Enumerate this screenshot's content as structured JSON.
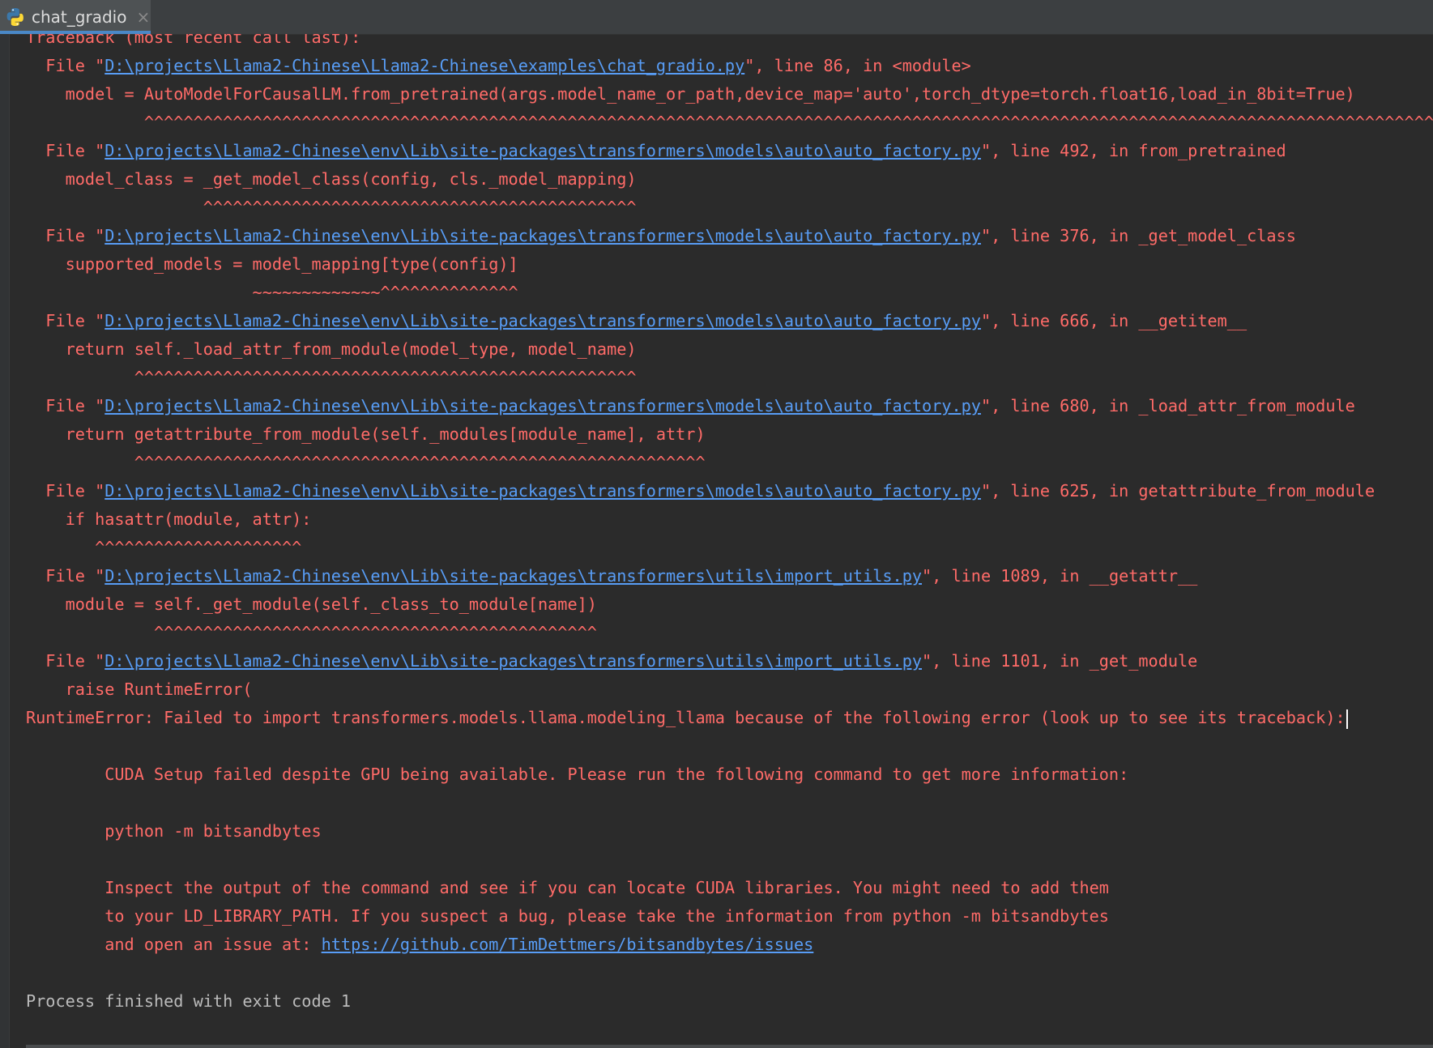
{
  "tab": {
    "title": "chat_gradio",
    "close_glyph": "×",
    "icon": "python-file-icon"
  },
  "console": {
    "partial_header": "Traceback (most recent call last):",
    "frames": [
      {
        "prefix": "  File \"",
        "path": "D:\\projects\\Llama2-Chinese\\Llama2-Chinese\\examples\\chat_gradio.py",
        "suffix": "\", line 86, in <module>",
        "code": "    model = AutoModelForCausalLM.from_pretrained(args.model_name_or_path,device_map='auto',torch_dtype=torch.float16,load_in_8bit=True)",
        "marker": "            ^^^^^^^^^^^^^^^^^^^^^^^^^^^^^^^^^^^^^^^^^^^^^^^^^^^^^^^^^^^^^^^^^^^^^^^^^^^^^^^^^^^^^^^^^^^^^^^^^^^^^^^^^^^^^^^^^^^^^^^^^^^^^^^^^^^^^^^^^^^^"
      },
      {
        "prefix": "  File \"",
        "path": "D:\\projects\\Llama2-Chinese\\env\\Lib\\site-packages\\transformers\\models\\auto\\auto_factory.py",
        "suffix": "\", line 492, in from_pretrained",
        "code": "    model_class = _get_model_class(config, cls._model_mapping)",
        "marker": "                  ^^^^^^^^^^^^^^^^^^^^^^^^^^^^^^^^^^^^^^^^^^^^"
      },
      {
        "prefix": "  File \"",
        "path": "D:\\projects\\Llama2-Chinese\\env\\Lib\\site-packages\\transformers\\models\\auto\\auto_factory.py",
        "suffix": "\", line 376, in _get_model_class",
        "code": "    supported_models = model_mapping[type(config)]",
        "marker": "                       ~~~~~~~~~~~~~^^^^^^^^^^^^^^"
      },
      {
        "prefix": "  File \"",
        "path": "D:\\projects\\Llama2-Chinese\\env\\Lib\\site-packages\\transformers\\models\\auto\\auto_factory.py",
        "suffix": "\", line 666, in __getitem__",
        "code": "    return self._load_attr_from_module(model_type, model_name)",
        "marker": "           ^^^^^^^^^^^^^^^^^^^^^^^^^^^^^^^^^^^^^^^^^^^^^^^^^^^"
      },
      {
        "prefix": "  File \"",
        "path": "D:\\projects\\Llama2-Chinese\\env\\Lib\\site-packages\\transformers\\models\\auto\\auto_factory.py",
        "suffix": "\", line 680, in _load_attr_from_module",
        "code": "    return getattribute_from_module(self._modules[module_name], attr)",
        "marker": "           ^^^^^^^^^^^^^^^^^^^^^^^^^^^^^^^^^^^^^^^^^^^^^^^^^^^^^^^^^^"
      },
      {
        "prefix": "  File \"",
        "path": "D:\\projects\\Llama2-Chinese\\env\\Lib\\site-packages\\transformers\\models\\auto\\auto_factory.py",
        "suffix": "\", line 625, in getattribute_from_module",
        "code": "    if hasattr(module, attr):",
        "marker": "       ^^^^^^^^^^^^^^^^^^^^^"
      },
      {
        "prefix": "  File \"",
        "path": "D:\\projects\\Llama2-Chinese\\env\\Lib\\site-packages\\transformers\\utils\\import_utils.py",
        "suffix": "\", line 1089, in __getattr__",
        "code": "    module = self._get_module(self._class_to_module[name])",
        "marker": "             ^^^^^^^^^^^^^^^^^^^^^^^^^^^^^^^^^^^^^^^^^^^^^"
      },
      {
        "prefix": "  File \"",
        "path": "D:\\projects\\Llama2-Chinese\\env\\Lib\\site-packages\\transformers\\utils\\import_utils.py",
        "suffix": "\", line 1101, in _get_module",
        "code": "    raise RuntimeError(",
        "marker": null
      }
    ],
    "error_line": "RuntimeError: Failed to import transformers.models.llama.modeling_llama because of the following error (look up to see its traceback):",
    "cuda_message": "        CUDA Setup failed despite GPU being available. Please run the following command to get more information:",
    "python_cmd": "        python -m bitsandbytes",
    "inspect_1": "        Inspect the output of the command and see if you can locate CUDA libraries. You might need to add them",
    "inspect_2": "        to your LD_LIBRARY_PATH. If you suspect a bug, please take the information from python -m bitsandbytes",
    "issue_prefix": "        and open an issue at: ",
    "issue_link": "https://github.com/TimDettmers/bitsandbytes/issues",
    "exit_message": "Process finished with exit code 1"
  },
  "colors": {
    "background": "#2b2b2b",
    "error_text": "#ff6b68",
    "link": "#589df6",
    "plain_text": "#bbbbbb",
    "tab_active": "#4e5254",
    "tab_underline": "#4a88c7"
  }
}
